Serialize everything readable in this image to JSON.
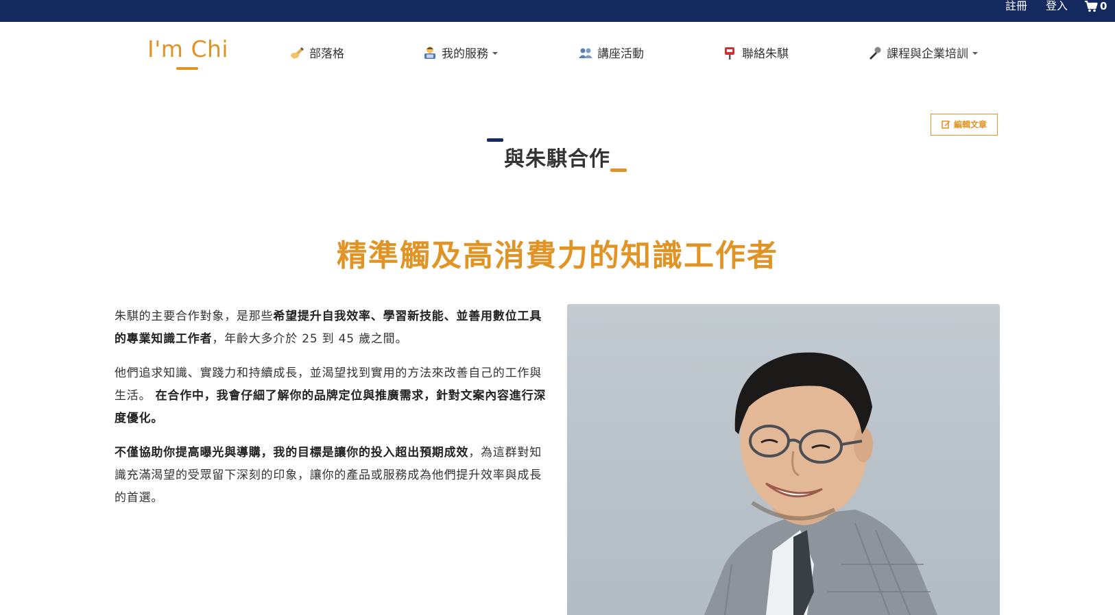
{
  "topbar": {
    "register": "註冊",
    "login": "登入",
    "cart_count": "0"
  },
  "header": {
    "logo": "I'm Chi",
    "nav": [
      {
        "label": "部落格",
        "icon": "writing-hand-icon",
        "dropdown": false
      },
      {
        "label": "我的服務",
        "icon": "technologist-icon",
        "dropdown": true
      },
      {
        "label": "講座活動",
        "icon": "people-icon",
        "dropdown": false
      },
      {
        "label": "聯絡朱騏",
        "icon": "mailbox-icon",
        "dropdown": false
      },
      {
        "label": "課程與企業培訓",
        "icon": "microphone-icon",
        "dropdown": true
      }
    ]
  },
  "edit_button": "編輯文章",
  "page_title": "與朱騏合作",
  "headline": "精準觸及高消費力的知識工作者",
  "content": {
    "p1": {
      "a": "朱騏的主要合作對象，是那些",
      "b": "希望提升自我效率、學習新技能、並善用數位工具的專業知識工作者",
      "c": "，年齡大多介於 25 到 45 歲之間。"
    },
    "p2": {
      "a": "他們追求知識、實踐力和持續成長，並渴望找到實用的方法來改善自己的工作與生活。 ",
      "b": "在合作中，我會仔細了解你的品牌定位與推廣需求，針對文案內容進行深度優化。"
    },
    "p3": {
      "a": "不僅協助你提高曝光與導購，我的目標是讓你的投入超出預期成效",
      "b": "，為這群對知識充滿渴望的受眾留下深刻的印象，讓你的產品或服務成為他們提升效率與成長的首選。"
    }
  },
  "colors": {
    "navy": "#14295e",
    "accent": "#e09425",
    "text": "#333333"
  }
}
